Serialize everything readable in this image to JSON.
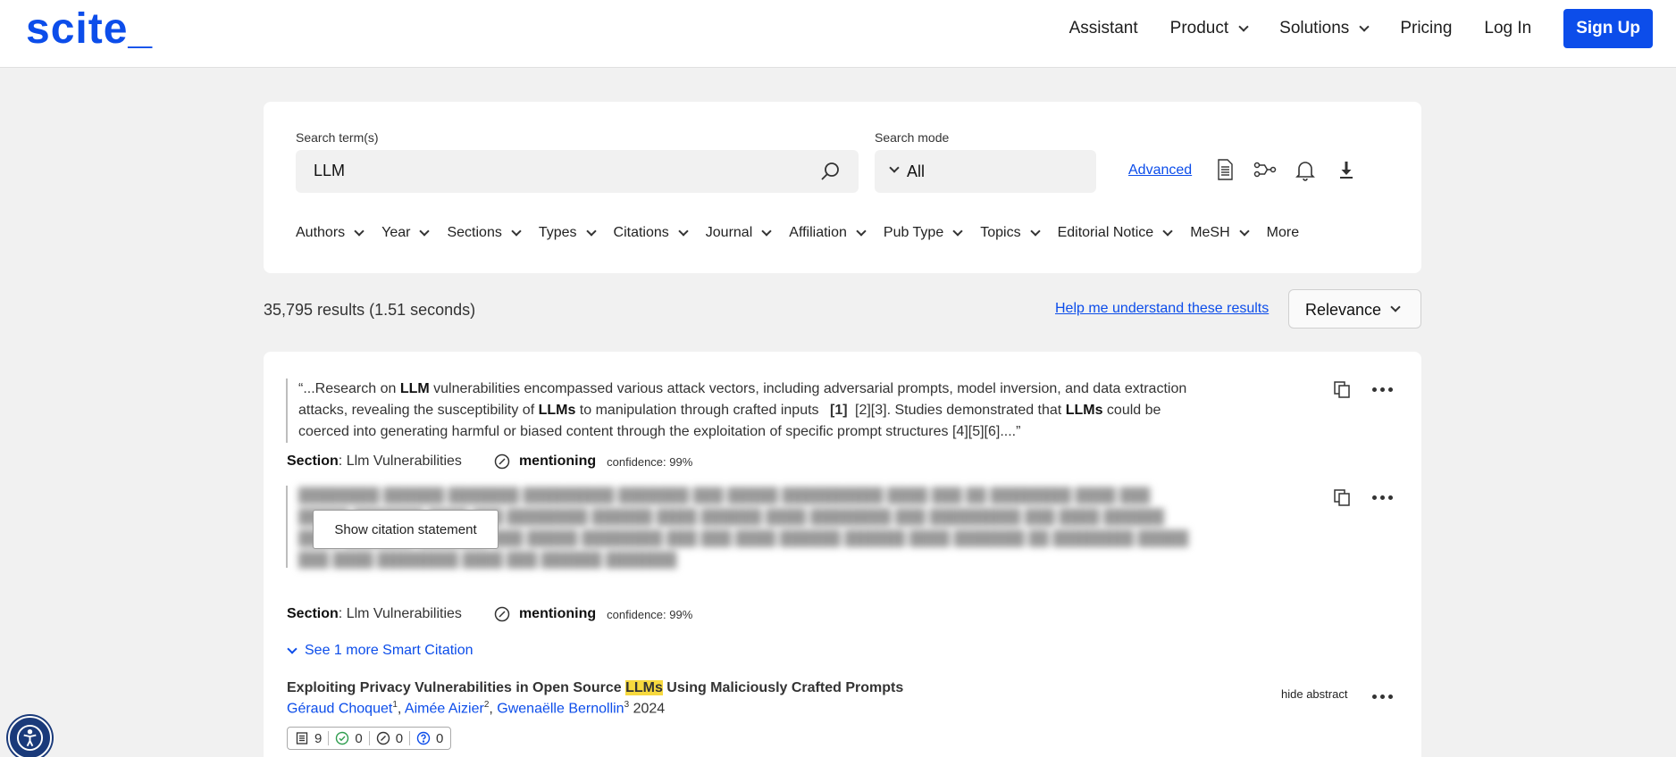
{
  "brand": {
    "logo": "scite_",
    "accent_color": "#0c4dea"
  },
  "nav": {
    "items": [
      {
        "label": "Assistant",
        "has_dropdown": false
      },
      {
        "label": "Product",
        "has_dropdown": true
      },
      {
        "label": "Solutions",
        "has_dropdown": true
      },
      {
        "label": "Pricing",
        "has_dropdown": false
      },
      {
        "label": "Log In",
        "has_dropdown": false
      }
    ],
    "signup_label": "Sign Up"
  },
  "search": {
    "term_label": "Search term(s)",
    "term_value": "LLM",
    "mode_label": "Search mode",
    "mode_value": "All",
    "advanced_label": "Advanced",
    "tool_icons": [
      "document-icon",
      "citation-map-icon",
      "bell-icon",
      "download-icon"
    ]
  },
  "filters": [
    "Authors",
    "Year",
    "Sections",
    "Types",
    "Citations",
    "Journal",
    "Affiliation",
    "Pub Type",
    "Topics",
    "Editorial Notice",
    "MeSH",
    "More"
  ],
  "results": {
    "count_text": "35,795 results (1.51 seconds)",
    "help_link": "Help me understand these results",
    "sort_value": "Relevance"
  },
  "citations": [
    {
      "quote_parts": [
        "“...Research on ",
        "LLM",
        " vulnerabilities encompassed various attack vectors, including adversarial prompts, model inversion, and data extraction attacks, revealing the susceptibility of ",
        "LLMs",
        " to manipulation through crafted inputs ",
        "[1]",
        " [2][3]. Studies demonstrated that ",
        "LLMs",
        " could be coerced into generating harmful or biased content through the exploitation of specific prompt structures [4][5][6]....”"
      ],
      "section_label": "Section",
      "section_value": ": Llm Vulnerabilities",
      "type": "mentioning",
      "confidence": "confidence: 99%"
    },
    {
      "button_label": "Show citation statement",
      "section_label": "Section",
      "section_value": ": Llm Vulnerabilities",
      "type": "mentioning",
      "confidence": "confidence: 99%"
    }
  ],
  "see_more": "See 1 more Smart Citation",
  "paper": {
    "title_before": "Exploiting Privacy Vulnerabilities in Open Source ",
    "title_highlight": "LLMs",
    "title_after": " Using Maliciously Crafted Prompts",
    "authors": [
      {
        "name": "Géraud Choquet",
        "sup": "1"
      },
      {
        "name": "Aimée Aizier",
        "sup": "2"
      },
      {
        "name": "Gwenaëlle Bernollin",
        "sup": "3"
      }
    ],
    "year": "2024",
    "hide_abstract": "hide abstract",
    "counts": {
      "publications": "9",
      "supporting": "0",
      "mentioning": "0",
      "contrasting": "0"
    }
  }
}
